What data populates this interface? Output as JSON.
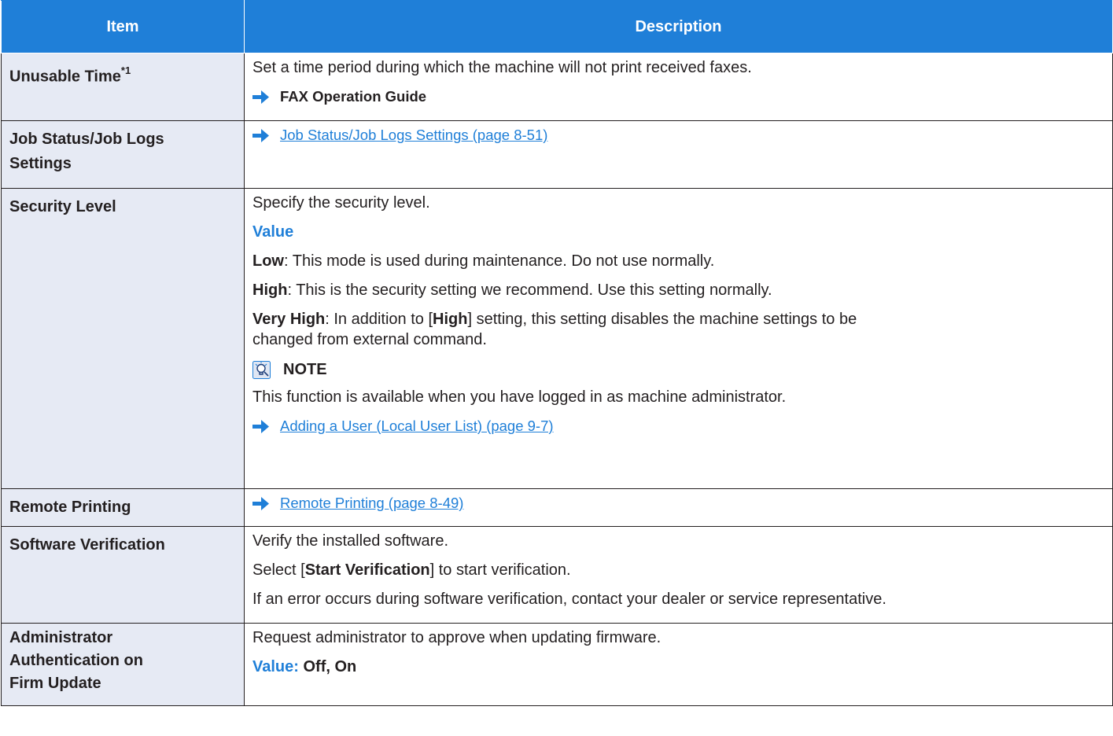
{
  "header": {
    "item": "Item",
    "description": "Description"
  },
  "rows": {
    "unusable_time": {
      "item": "Unusable Time",
      "footnote": "*1",
      "desc": "Set a time period during which the machine will not print received faxes.",
      "ref": "FAX Operation Guide"
    },
    "job_status": {
      "item_line1": "Job Status/Job Logs",
      "item_line2": "Settings",
      "link": "Job Status/Job Logs Settings (page 8-51)"
    },
    "security_level": {
      "item": "Security Level",
      "desc": "Specify the security level.",
      "value_heading": "Value",
      "low_label": "Low",
      "low_text": ": This mode is used during maintenance. Do not use normally.",
      "high_label": "High",
      "high_text": ": This is the security setting we recommend. Use this setting normally.",
      "very_high_label": "Very High",
      "very_high_text_1": ": In addition to [",
      "very_high_inner": "High",
      "very_high_text_2": "] setting, this setting disables the machine settings to be",
      "very_high_text_3": "changed from external command.",
      "note_title": "NOTE",
      "note_text": "This function is available when you have logged in as machine administrator.",
      "link": "Adding a User (Local User List) (page 9-7)"
    },
    "remote_printing": {
      "item": "Remote Printing",
      "link": "Remote Printing (page 8-49)"
    },
    "software_verification": {
      "item": "Software Verification",
      "desc1": "Verify the installed software.",
      "desc2_pre": "Select [",
      "desc2_bold": "Start Verification",
      "desc2_post": "] to start verification.",
      "desc3": "If an error occurs during software verification, contact your dealer or service representative."
    },
    "admin_auth": {
      "item_line1": "Administrator",
      "item_line2": "Authentication on",
      "item_line3": "Firm Update",
      "desc": "Request administrator to approve when updating firmware.",
      "value_label": "Value: ",
      "value_text": "Off, On"
    }
  },
  "colors": {
    "header_bg": "#1f7fd8",
    "item_bg": "#e6eaf4",
    "link": "#1f7fd8",
    "border": "#231f20"
  }
}
